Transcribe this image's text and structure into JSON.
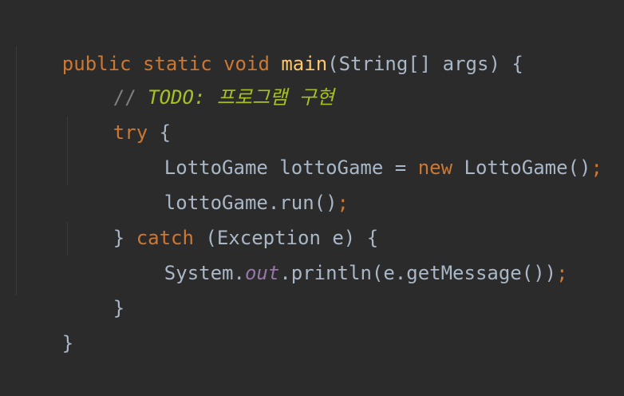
{
  "lines": [
    {
      "parts": [
        "public",
        "static",
        "void",
        "main",
        "(String[] args) {"
      ]
    },
    {
      "parts": [
        "// ",
        "TODO",
        ": 프로그램 구현"
      ]
    },
    {
      "parts": [
        "try",
        " {"
      ]
    },
    {
      "parts": [
        "LottoGame lottoGame = ",
        "new",
        " LottoGame()",
        ";"
      ]
    },
    {
      "parts": [
        "lottoGame.run()",
        ";"
      ]
    },
    {
      "parts": [
        "} ",
        "catch",
        " (Exception e) {"
      ]
    },
    {
      "parts": [
        "System.",
        "out",
        ".println(e.getMessage())",
        ";"
      ]
    },
    {
      "parts": [
        "}"
      ]
    },
    {
      "parts": [
        "}"
      ]
    }
  ]
}
